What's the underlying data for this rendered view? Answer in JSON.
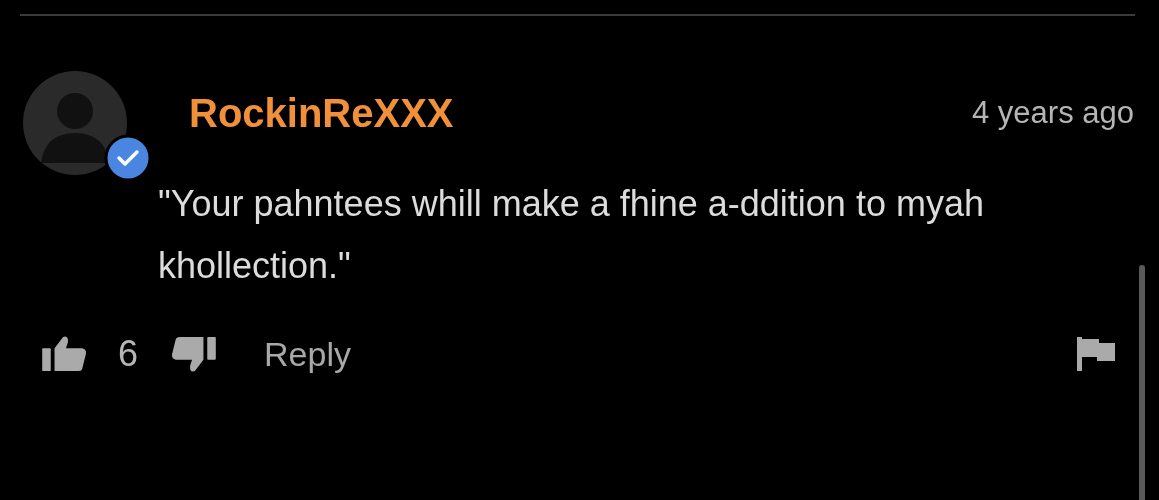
{
  "comment": {
    "username": "RockinReXXX",
    "verified": true,
    "time": "4 years ago",
    "text": "\"Your pahntees whill make a fhine a-ddition to myah khollection.\"",
    "likes": "6",
    "reply": "Reply"
  }
}
